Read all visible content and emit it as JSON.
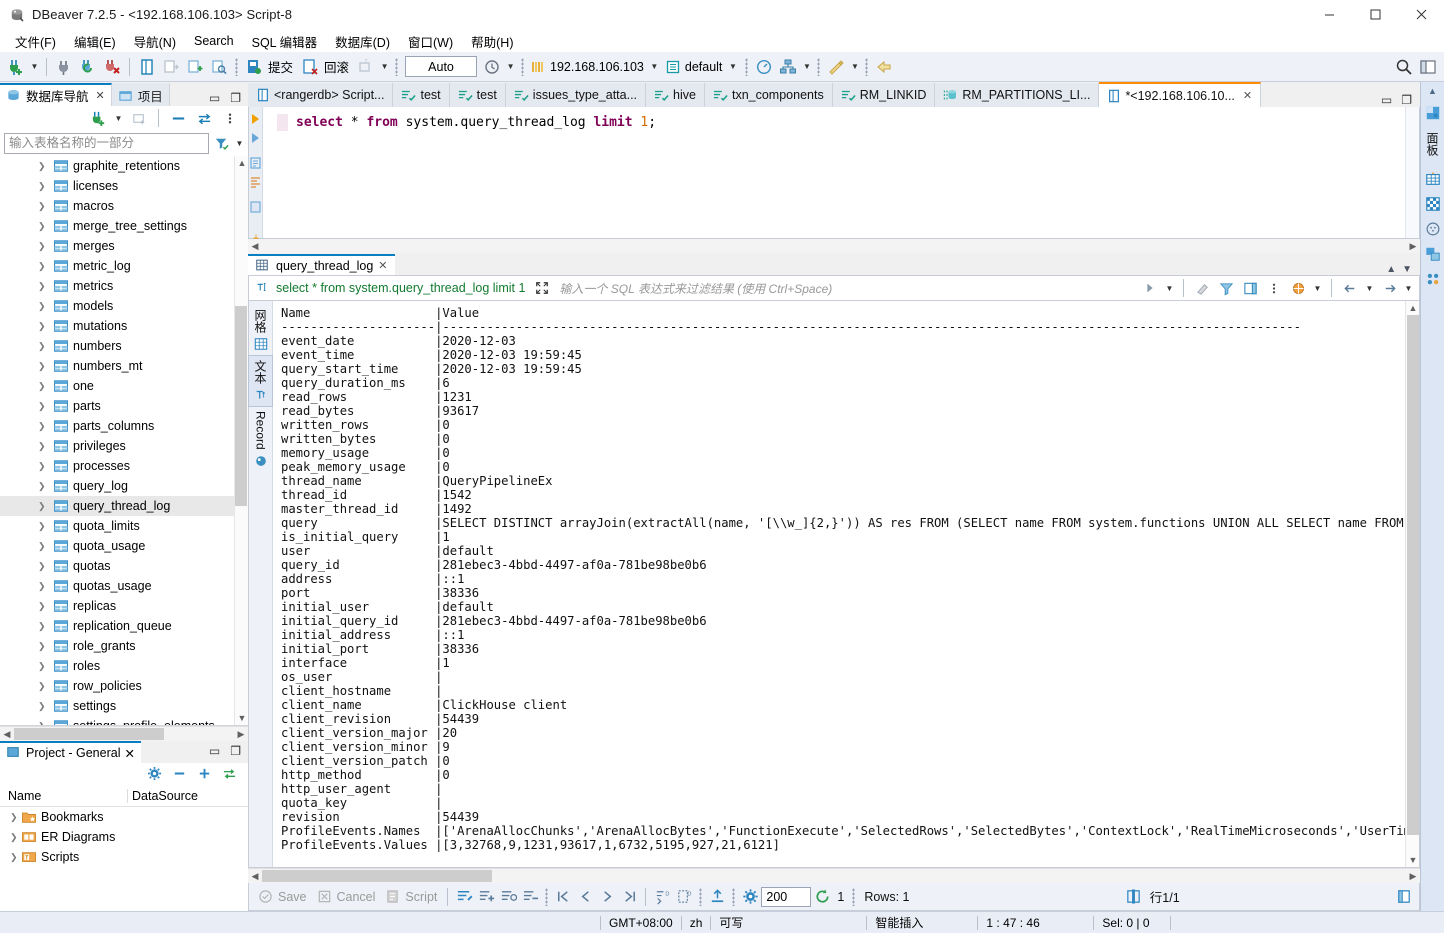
{
  "window": {
    "title": "DBeaver 7.2.5 - <192.168.106.103> Script-8",
    "app_icon": "dbeaver-icon",
    "minimize": "—",
    "maximize": "☐",
    "close": "✕"
  },
  "menubar": {
    "items": [
      {
        "label": "文件(F)",
        "name": "menu-file"
      },
      {
        "label": "编辑(E)",
        "name": "menu-edit"
      },
      {
        "label": "导航(N)",
        "name": "menu-navigate"
      },
      {
        "label": "Search",
        "name": "menu-search"
      },
      {
        "label": "SQL 编辑器",
        "name": "menu-sql-editor"
      },
      {
        "label": "数据库(D)",
        "name": "menu-database"
      },
      {
        "label": "窗口(W)",
        "name": "menu-window"
      },
      {
        "label": "帮助(H)",
        "name": "menu-help"
      }
    ]
  },
  "toolbar": {
    "commit_label": "提交",
    "rollback_label": "回滚",
    "auto_commit_value": "Auto",
    "connection_name": "192.168.106.103",
    "database_name": "default"
  },
  "navigator": {
    "tab_label": "数据库导航",
    "tab_label_2": "项目",
    "filter_placeholder": "输入表格名称的一部分",
    "items": [
      {
        "label": "graphite_retentions",
        "selected": false
      },
      {
        "label": "licenses",
        "selected": false
      },
      {
        "label": "macros",
        "selected": false
      },
      {
        "label": "merge_tree_settings",
        "selected": false
      },
      {
        "label": "merges",
        "selected": false
      },
      {
        "label": "metric_log",
        "selected": false
      },
      {
        "label": "metrics",
        "selected": false
      },
      {
        "label": "models",
        "selected": false
      },
      {
        "label": "mutations",
        "selected": false
      },
      {
        "label": "numbers",
        "selected": false
      },
      {
        "label": "numbers_mt",
        "selected": false
      },
      {
        "label": "one",
        "selected": false
      },
      {
        "label": "parts",
        "selected": false
      },
      {
        "label": "parts_columns",
        "selected": false
      },
      {
        "label": "privileges",
        "selected": false
      },
      {
        "label": "processes",
        "selected": false
      },
      {
        "label": "query_log",
        "selected": false
      },
      {
        "label": "query_thread_log",
        "selected": true
      },
      {
        "label": "quota_limits",
        "selected": false
      },
      {
        "label": "quota_usage",
        "selected": false
      },
      {
        "label": "quotas",
        "selected": false
      },
      {
        "label": "quotas_usage",
        "selected": false
      },
      {
        "label": "replicas",
        "selected": false
      },
      {
        "label": "replication_queue",
        "selected": false
      },
      {
        "label": "role_grants",
        "selected": false
      },
      {
        "label": "roles",
        "selected": false
      },
      {
        "label": "row_policies",
        "selected": false
      },
      {
        "label": "settings",
        "selected": false
      },
      {
        "label": "settings_profile_elements",
        "selected": false
      }
    ]
  },
  "project_panel": {
    "tab_label": "Project - General",
    "col_name": "Name",
    "col_datasource": "DataSource",
    "rows": [
      {
        "label": "Bookmarks"
      },
      {
        "label": "ER Diagrams"
      },
      {
        "label": "Scripts"
      }
    ]
  },
  "editor_tabs": [
    {
      "label": "<rangerdb> Script...",
      "icon": "sql-script-icon",
      "active": false
    },
    {
      "label": "test",
      "icon": "table-check-icon",
      "active": false
    },
    {
      "label": "test",
      "icon": "table-check-icon",
      "active": false
    },
    {
      "label": "issues_type_atta...",
      "icon": "table-check-icon",
      "active": false
    },
    {
      "label": "hive",
      "icon": "table-check-icon",
      "active": false
    },
    {
      "label": "txn_components",
      "icon": "table-check-icon",
      "active": false
    },
    {
      "label": "RM_LINKID",
      "icon": "table-check-icon",
      "active": false
    },
    {
      "label": "RM_PARTITIONS_LI...",
      "icon": "db-table-icon",
      "active": false
    },
    {
      "label": "*<192.168.106.10...",
      "icon": "sql-script-icon",
      "active": true
    }
  ],
  "sql_editor": {
    "statement_parts": [
      {
        "t": "select",
        "c": "kw"
      },
      {
        "t": " * ",
        "c": "op"
      },
      {
        "t": "from",
        "c": "kw"
      },
      {
        "t": " system.query_thread_log ",
        "c": "op"
      },
      {
        "t": "limit",
        "c": "kw"
      },
      {
        "t": " ",
        "c": "op"
      },
      {
        "t": "1",
        "c": "num"
      },
      {
        "t": ";",
        "c": "op"
      }
    ],
    "statement_plain": "select * from system.query_thread_log limit 1;"
  },
  "results": {
    "tab_label": "query_thread_log",
    "filter_query": "select * from system.query_thread_log limit 1",
    "filter_placeholder": "输入一个 SQL 表达式来过滤结果 (使用 Ctrl+Space)",
    "vtab_grid": "网格",
    "vtab_text": "文本",
    "vtab_record": "Record",
    "text_lines": [
      "Name                 |Value",
      "---------------------|---------------------------------------------------------------------------------------------------------------------",
      "event_date           |2020-12-03",
      "event_time           |2020-12-03 19:59:45",
      "query_start_time     |2020-12-03 19:59:45",
      "query_duration_ms    |6",
      "read_rows            |1231",
      "read_bytes           |93617",
      "written_rows         |0",
      "written_bytes        |0",
      "memory_usage         |0",
      "peak_memory_usage    |0",
      "thread_name          |QueryPipelineEx",
      "thread_id            |1542",
      "master_thread_id     |1492",
      "query                |SELECT DISTINCT arrayJoin(extractAll(name, '[\\\\w_]{2,}')) AS res FROM (SELECT name FROM system.functions UNION ALL SELECT name FROM system.",
      "is_initial_query     |1",
      "user                 |default",
      "query_id             |281ebec3-4bbd-4497-af0a-781be98be0b6",
      "address              |::1",
      "port                 |38336",
      "initial_user         |default",
      "initial_query_id     |281ebec3-4bbd-4497-af0a-781be98be0b6",
      "initial_address      |::1",
      "initial_port         |38336",
      "interface            |1",
      "os_user              |",
      "client_hostname      |",
      "client_name          |ClickHouse client",
      "client_revision      |54439",
      "client_version_major |20",
      "client_version_minor |9",
      "client_version_patch |0",
      "http_method          |0",
      "http_user_agent      |",
      "quota_key            |",
      "revision             |54439",
      "ProfileEvents.Names  |['ArenaAllocChunks','ArenaAllocBytes','FunctionExecute','SelectedRows','SelectedBytes','ContextLock','RealTimeMicroseconds','UserTimeMicros",
      "ProfileEvents.Values |[3,32768,9,1231,93617,1,6732,5195,927,21,6121]"
    ],
    "bottom_toolbar": {
      "save_label": "Save",
      "cancel_label": "Cancel",
      "script_label": "Script",
      "fetch_size_value": "200",
      "refresh_count": "1",
      "rows_label": "Rows: 1",
      "position_label": "行1/1"
    }
  },
  "statusbar": {
    "timezone": "GMT+08:00",
    "lang": "zh",
    "writable": "可写",
    "insert_mode": "智能插入",
    "caret": "1 : 47 : 46",
    "selection": "Sel: 0 | 0"
  }
}
